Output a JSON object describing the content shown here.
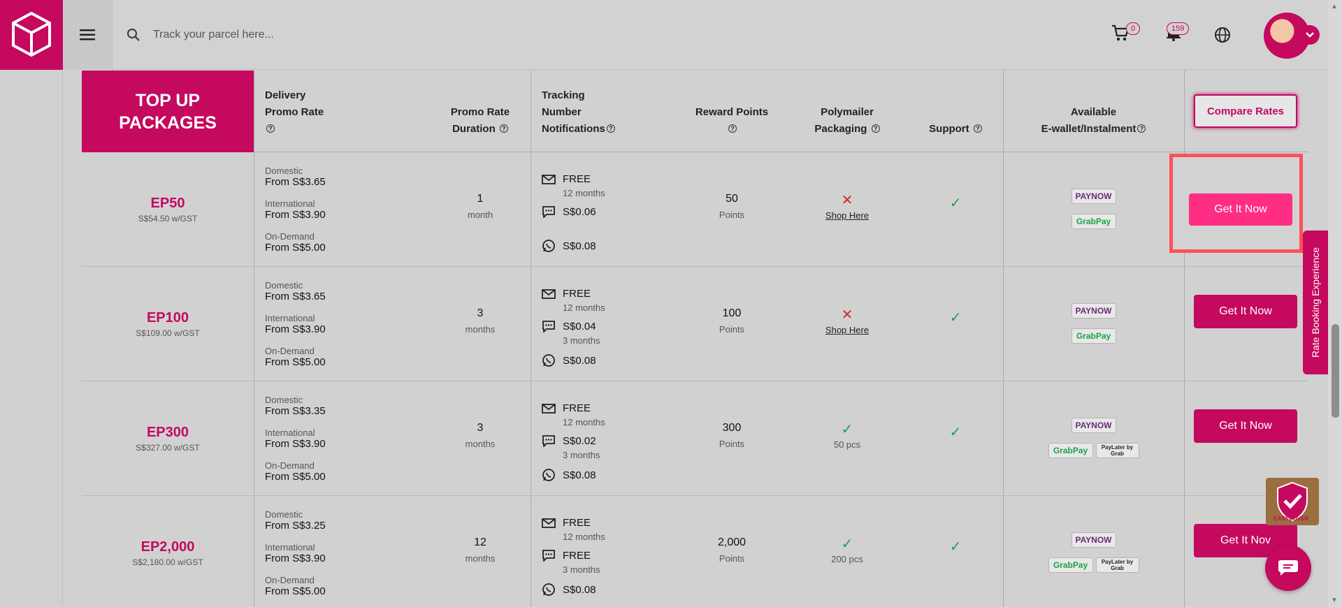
{
  "header": {
    "search_placeholder": "Track your parcel here...",
    "cart_count": "0",
    "notification_count": "159"
  },
  "table": {
    "title_line1": "TOP UP",
    "title_line2": "PACKAGES",
    "headers": {
      "delivery_l1": "Delivery",
      "delivery_l2": "Promo Rate",
      "duration_l1": "Promo Rate",
      "duration_l2": "Duration",
      "tracking_l1": "Tracking",
      "tracking_l2": "Number",
      "tracking_l3": "Notifications",
      "reward": "Reward Points",
      "poly_l1": "Polymailer",
      "poly_l2": "Packaging",
      "support": "Support",
      "ewallet_l1": "Available",
      "ewallet_l2": "E-wallet/Instalment"
    },
    "compare_label": "Compare Rates",
    "rate_labels": {
      "domestic": "Domestic",
      "international": "International",
      "ondemand": "On-Demand"
    },
    "rows": [
      {
        "name": "EP50",
        "price": "S$54.50 w/GST",
        "domestic": "From S$3.65",
        "international": "From S$3.90",
        "ondemand": "From S$5.00",
        "duration": "1",
        "duration_unit": "month",
        "email": "FREE",
        "email_sub": "12 months",
        "sms": "S$0.06",
        "sms_sub": "",
        "whatsapp": "S$0.08",
        "points": "50",
        "points_unit": "Points",
        "poly": "cross",
        "poly_text": "Shop Here",
        "support": "check",
        "button": "Get It Now"
      },
      {
        "name": "EP100",
        "price": "S$109.00 w/GST",
        "domestic": "From S$3.65",
        "international": "From S$3.90",
        "ondemand": "From S$5.00",
        "duration": "3",
        "duration_unit": "months",
        "email": "FREE",
        "email_sub": "12 months",
        "sms": "S$0.04",
        "sms_sub": "3 months",
        "whatsapp": "S$0.08",
        "points": "100",
        "points_unit": "Points",
        "poly": "cross",
        "poly_text": "Shop Here",
        "support": "check",
        "button": "Get It Now"
      },
      {
        "name": "EP300",
        "price": "S$327.00 w/GST",
        "domestic": "From S$3.35",
        "international": "From S$3.90",
        "ondemand": "From S$5.00",
        "duration": "3",
        "duration_unit": "months",
        "email": "FREE",
        "email_sub": "12 months",
        "sms": "S$0.02",
        "sms_sub": "3 months",
        "whatsapp": "S$0.08",
        "points": "300",
        "points_unit": "Points",
        "poly": "check",
        "poly_text": "50 pcs",
        "support": "check",
        "button": "Get It Now"
      },
      {
        "name": "EP2,000",
        "price": "S$2,180.00 w/GST",
        "domestic": "From S$3.25",
        "international": "From S$3.90",
        "ondemand": "From S$5.00",
        "duration": "12",
        "duration_unit": "months",
        "email": "FREE",
        "email_sub": "12 months",
        "sms": "FREE",
        "sms_sub": "3 months",
        "whatsapp": "S$0.08",
        "points": "2,000",
        "points_unit": "Points",
        "poly": "check",
        "poly_text": "200 pcs",
        "support": "check",
        "button": "Get It Nov"
      }
    ]
  },
  "payments": {
    "paynow": "PAYNOW",
    "grabpay": "GrabPay",
    "paylater": "PayLater by Grab"
  },
  "side_tab": "Rate Booking Experience",
  "easycover_label": "EASYCOVER",
  "colors": {
    "brand": "#c4095f",
    "highlight": "#ff4f5a",
    "check": "#1aa34a",
    "cross": "#d02a2a"
  }
}
